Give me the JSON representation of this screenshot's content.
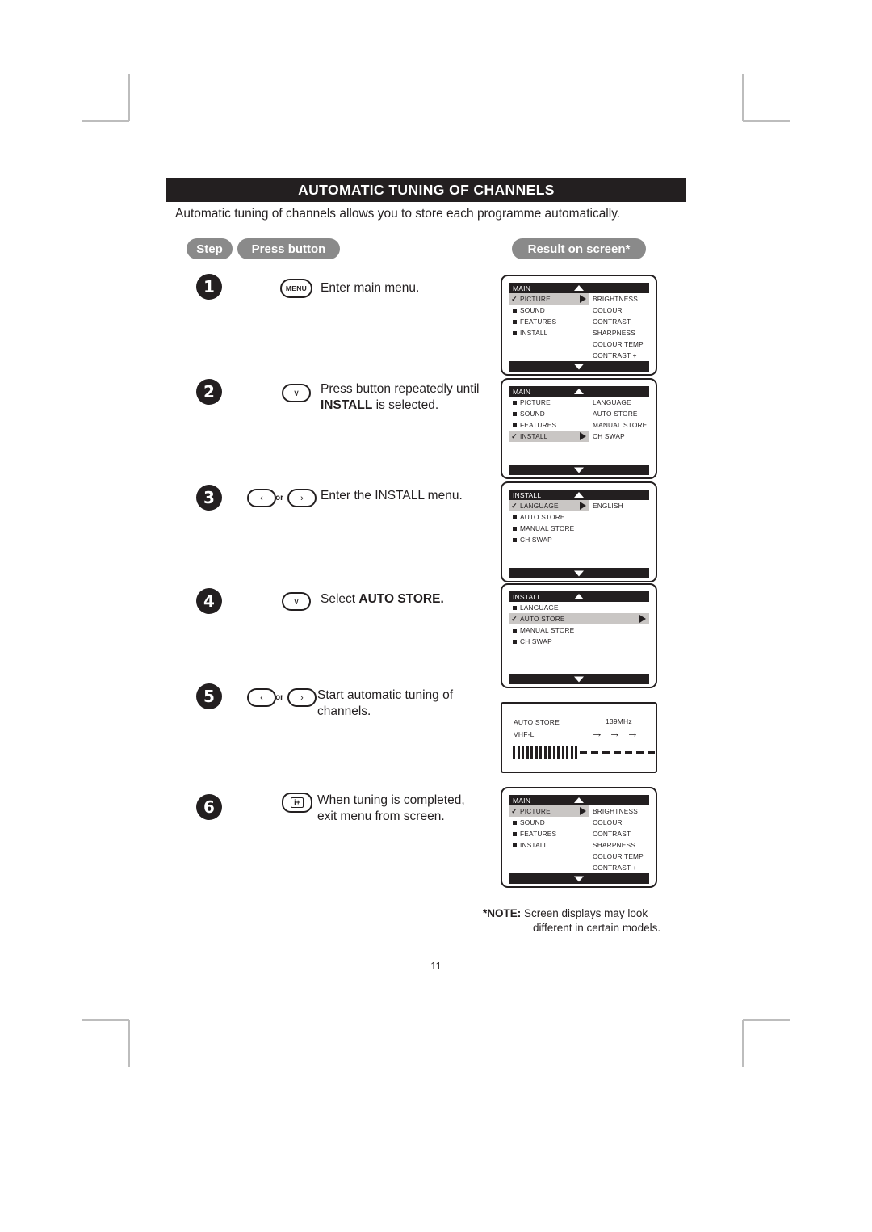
{
  "document": {
    "title": "AUTOMATIC TUNING OF CHANNELS",
    "intro": "Automatic tuning of channels allows you to store each programme automatically.",
    "page_number": "11"
  },
  "headers": {
    "step": "Step",
    "press_button": "Press button",
    "result_on_screen": "Result on screen*"
  },
  "steps": [
    {
      "number": "1",
      "button": {
        "type": "menu",
        "label": "MENU"
      },
      "instruction": "Enter main menu.",
      "instruction_bold": "",
      "instruction_tail": ""
    },
    {
      "number": "2",
      "button": {
        "type": "chevron-down",
        "label": "∨"
      },
      "instruction": "Press button repeatedly until ",
      "instruction_bold": "INSTALL",
      "instruction_tail": " is selected."
    },
    {
      "number": "3",
      "button": {
        "type": "left-or-right",
        "left": "‹",
        "or": "or",
        "right": "›"
      },
      "instruction": "Enter the INSTALL menu.",
      "instruction_bold": "",
      "instruction_tail": ""
    },
    {
      "number": "4",
      "button": {
        "type": "chevron-down",
        "label": "∨"
      },
      "instruction": "Select ",
      "instruction_bold": "AUTO STORE.",
      "instruction_tail": ""
    },
    {
      "number": "5",
      "button": {
        "type": "left-or-right",
        "left": "‹",
        "or": "or",
        "right": "›"
      },
      "instruction": "Start automatic tuning of channels.",
      "instruction_bold": "",
      "instruction_tail": ""
    },
    {
      "number": "6",
      "button": {
        "type": "info-plus",
        "label": "i+"
      },
      "instruction": "When tuning is completed, exit menu from screen.",
      "instruction_bold": "",
      "instruction_tail": ""
    }
  ],
  "screens": {
    "screen1": {
      "menu_title": "MAIN",
      "rows": [
        {
          "label": "PICTURE",
          "selected": true,
          "arrow": true
        },
        {
          "label": "SOUND",
          "selected": false,
          "arrow": false
        },
        {
          "label": "FEATURES",
          "selected": false,
          "arrow": false
        },
        {
          "label": "INSTALL",
          "selected": false,
          "arrow": false
        }
      ],
      "submenu": [
        "BRIGHTNESS",
        "COLOUR",
        "CONTRAST",
        "SHARPNESS",
        "COLOUR TEMP",
        "CONTRAST +"
      ]
    },
    "screen2": {
      "menu_title": "MAIN",
      "rows": [
        {
          "label": "PICTURE",
          "selected": false,
          "arrow": false
        },
        {
          "label": "SOUND",
          "selected": false,
          "arrow": false
        },
        {
          "label": "FEATURES",
          "selected": false,
          "arrow": false
        },
        {
          "label": "INSTALL",
          "selected": true,
          "arrow": true
        }
      ],
      "submenu": [
        "LANGUAGE",
        "AUTO  STORE",
        "MANUAL  STORE",
        "CH  SWAP"
      ]
    },
    "screen3": {
      "menu_title": "INSTALL",
      "rows": [
        {
          "label": "LANGUAGE",
          "selected": true,
          "arrow": true
        },
        {
          "label": "AUTO  STORE",
          "selected": false,
          "arrow": false
        },
        {
          "label": "MANUAL  STORE",
          "selected": false,
          "arrow": false
        },
        {
          "label": "CH  SWAP",
          "selected": false,
          "arrow": false
        }
      ],
      "submenu": [
        "ENGLISH"
      ]
    },
    "screen4": {
      "menu_title": "INSTALL",
      "rows": [
        {
          "label": "LANGUAGE",
          "selected": false,
          "arrow": false
        },
        {
          "label": "AUTO STORE",
          "selected": true,
          "arrow": true
        },
        {
          "label": "MANUAL  STORE",
          "selected": false,
          "arrow": false
        },
        {
          "label": "CH  SWAP",
          "selected": false,
          "arrow": false
        }
      ],
      "submenu": []
    },
    "screen5": {
      "mode_label": "AUTO STORE",
      "frequency": "139MHz",
      "band": "VHF-L",
      "arrows": "→ → →",
      "progress_filled": 15,
      "progress_empty": 7
    },
    "screen6": {
      "menu_title": "MAIN",
      "rows": [
        {
          "label": "PICTURE",
          "selected": true,
          "arrow": true
        },
        {
          "label": "SOUND",
          "selected": false,
          "arrow": false
        },
        {
          "label": "FEATURES",
          "selected": false,
          "arrow": false
        },
        {
          "label": "INSTALL",
          "selected": false,
          "arrow": false
        }
      ],
      "submenu": [
        "BRIGHTNESS",
        "COLOUR",
        "CONTRAST",
        "SHARPNESS",
        "COLOUR TEMP",
        "CONTRAST +"
      ]
    }
  },
  "note": {
    "star_label": "*NOTE:",
    "line1": "Screen displays may look",
    "line2": "different in certain models."
  },
  "colors": {
    "ink": "#231f20",
    "pill_gray": "#8a8a8a",
    "row_highlight": "#c9c6c4",
    "crop_mark": "#bdbdbd"
  }
}
